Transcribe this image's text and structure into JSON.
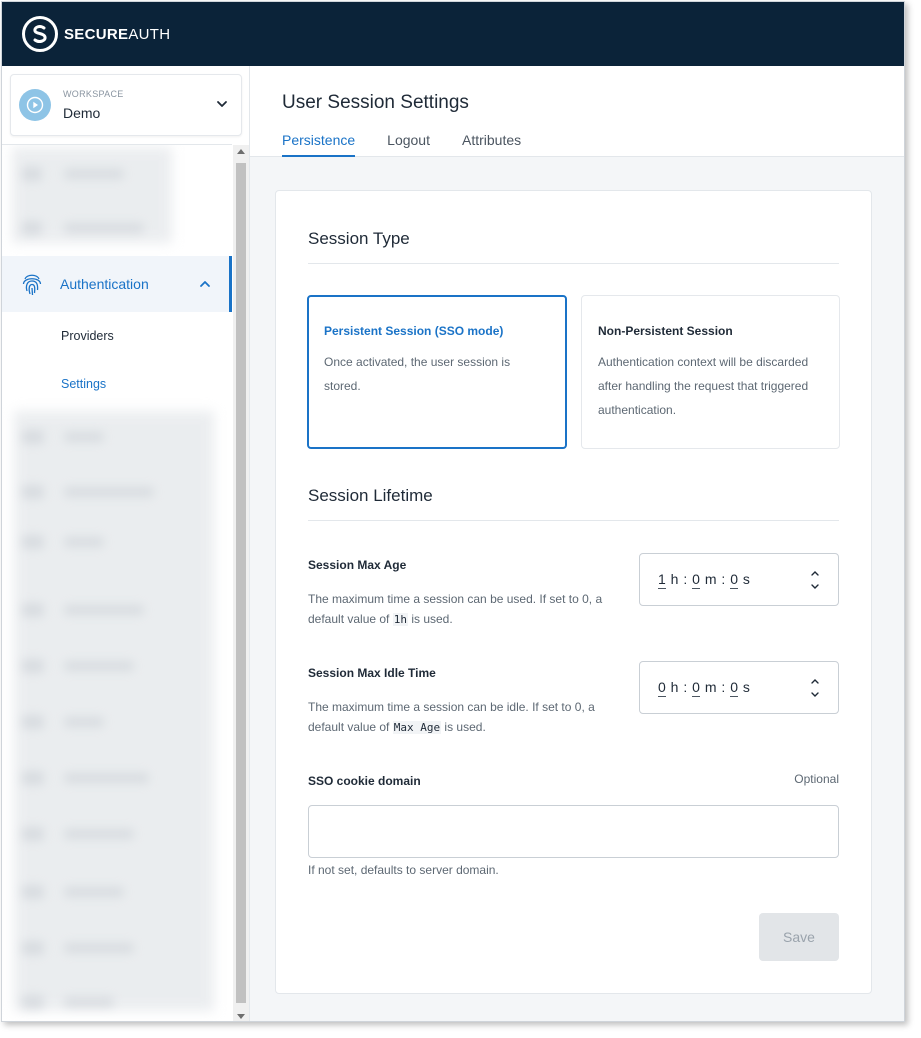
{
  "brand": {
    "logo_bold": "SECURE",
    "logo_light": "AUTH"
  },
  "workspace": {
    "label": "WORKSPACE",
    "name": "Demo"
  },
  "sidebar": {
    "auth_label": "Authentication",
    "sub_items": [
      {
        "label": "Providers",
        "active": false
      },
      {
        "label": "Settings",
        "active": true
      }
    ]
  },
  "page": {
    "title": "User Session Settings",
    "tabs": [
      {
        "label": "Persistence",
        "active": true
      },
      {
        "label": "Logout",
        "active": false
      },
      {
        "label": "Attributes",
        "active": false
      }
    ]
  },
  "session_type": {
    "title": "Session Type",
    "options": [
      {
        "title": "Persistent Session (SSO mode)",
        "desc": "Once activated, the user session is stored.",
        "selected": true
      },
      {
        "title": "Non-Persistent Session",
        "desc": "Authentication context will be discarded after handling the request that triggered authentication.",
        "selected": false
      }
    ]
  },
  "session_lifetime": {
    "title": "Session Lifetime",
    "max_age": {
      "label": "Session Max Age",
      "help_pre": "The maximum time a session can be used. If set to 0, a default value of ",
      "help_code": "1h",
      "help_post": " is used.",
      "h": "1",
      "m": "0",
      "s": "0"
    },
    "max_idle": {
      "label": "Session Max Idle Time",
      "help_pre": "The maximum time a session can be idle. If set to 0, a default value of ",
      "help_code": "Max Age",
      "help_post": " is used.",
      "h": "0",
      "m": "0",
      "s": "0"
    }
  },
  "cookie_domain": {
    "label": "SSO cookie domain",
    "optional": "Optional",
    "value": "",
    "help": "If not set, defaults to server domain."
  },
  "save_label": "Save",
  "colors": {
    "accent": "#1a73c7",
    "topbar": "#0b2339",
    "avatar": "#8ec4e6"
  }
}
